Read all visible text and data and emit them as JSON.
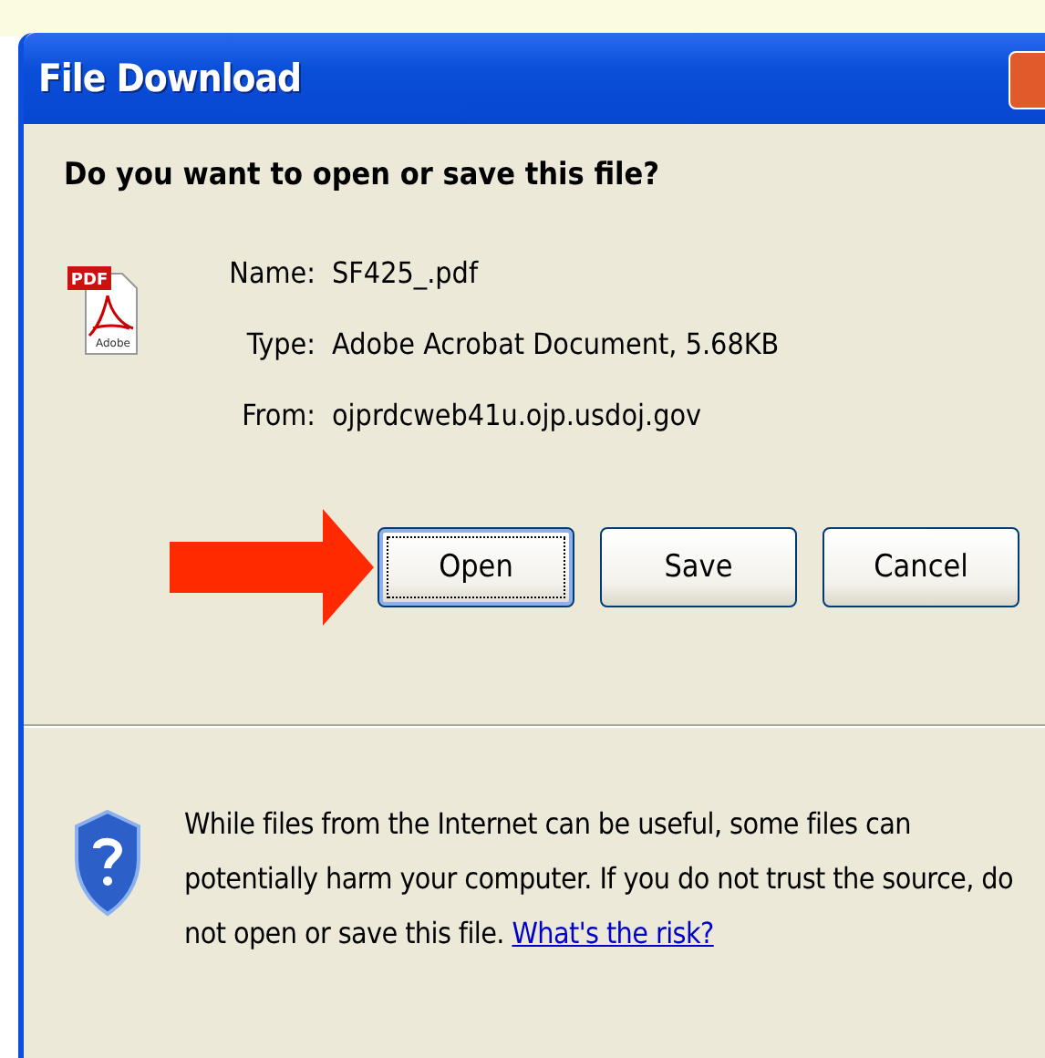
{
  "window": {
    "title": "File Download"
  },
  "question": "Do you want to open or save this file?",
  "file_icon": {
    "badge": "PDF",
    "caption": "Adobe"
  },
  "details": [
    {
      "label": "Name:",
      "value": "SF425_.pdf"
    },
    {
      "label": "Type:",
      "value": "Adobe Acrobat Document, 5.68KB"
    },
    {
      "label": "From:",
      "value": "ojprdcweb41u.ojp.usdoj.gov"
    }
  ],
  "buttons": [
    {
      "label": "Open",
      "focused": true
    },
    {
      "label": "Save",
      "focused": false
    },
    {
      "label": "Cancel",
      "focused": false
    }
  ],
  "warning": {
    "text": "While files from the Internet can be useful, some files can potentially harm your computer. If you do not trust the source, do not open or save this file.",
    "link": "What's the risk?"
  }
}
